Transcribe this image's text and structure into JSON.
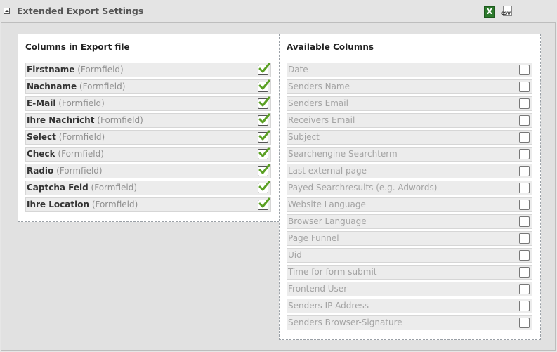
{
  "header": {
    "title": "Extended Export Settings",
    "excel_glyph": "X",
    "csv_label": "csv",
    "icons": [
      "collapse-icon",
      "excel-icon",
      "csv-icon"
    ]
  },
  "selected_panel": {
    "title": "Columns in Export file",
    "items": [
      {
        "name": "Firstname",
        "suffix": "(Formfield)",
        "checked": true
      },
      {
        "name": "Nachname",
        "suffix": "(Formfield)",
        "checked": true
      },
      {
        "name": "E-Mail",
        "suffix": "(Formfield)",
        "checked": true
      },
      {
        "name": "Ihre Nachricht",
        "suffix": "(Formfield)",
        "checked": true
      },
      {
        "name": "Select",
        "suffix": "(Formfield)",
        "checked": true
      },
      {
        "name": "Check",
        "suffix": "(Formfield)",
        "checked": true
      },
      {
        "name": "Radio",
        "suffix": "(Formfield)",
        "checked": true
      },
      {
        "name": "Captcha Feld",
        "suffix": "(Formfield)",
        "checked": true
      },
      {
        "name": "Ihre Location",
        "suffix": "(Formfield)",
        "checked": true
      }
    ]
  },
  "available_panel": {
    "title": "Available Columns",
    "items": [
      {
        "name": "Date",
        "checked": false
      },
      {
        "name": "Senders Name",
        "checked": false
      },
      {
        "name": "Senders Email",
        "checked": false
      },
      {
        "name": "Receivers Email",
        "checked": false
      },
      {
        "name": "Subject",
        "checked": false
      },
      {
        "name": "Searchengine Searchterm",
        "checked": false
      },
      {
        "name": "Last external page",
        "checked": false
      },
      {
        "name": "Payed Searchresults (e.g. Adwords)",
        "checked": false
      },
      {
        "name": "Website Language",
        "checked": false
      },
      {
        "name": "Browser Language",
        "checked": false
      },
      {
        "name": "Page Funnel",
        "checked": false
      },
      {
        "name": "Uid",
        "checked": false
      },
      {
        "name": "Time for form submit",
        "checked": false
      },
      {
        "name": "Frontend User",
        "checked": false
      },
      {
        "name": "Senders IP-Address",
        "checked": false
      },
      {
        "name": "Senders Browser-Signature",
        "checked": false
      }
    ]
  },
  "colors": {
    "check_green": "#5aa023",
    "row_bg": "#ececec"
  }
}
